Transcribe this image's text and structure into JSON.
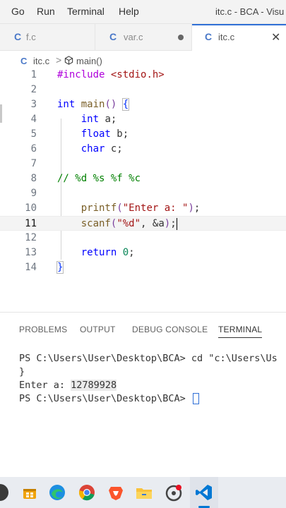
{
  "menubar": {
    "items": [
      "Go",
      "Run",
      "Terminal",
      "Help"
    ],
    "window_title": "itc.c - BCA - Visu"
  },
  "tabs": [
    {
      "icon": "C",
      "label": "f.c"
    },
    {
      "icon": "C",
      "label": "var.c",
      "modified": true
    },
    {
      "icon": "C",
      "label": "itc.c",
      "active": true,
      "close": "✕"
    }
  ],
  "breadcrumb": {
    "file_icon": "C",
    "file": "itc.c",
    "separator": ">",
    "symbol": "main()"
  },
  "code_lines": [
    {
      "n": "1",
      "text": "#include <stdio.h>"
    },
    {
      "n": "2",
      "text": ""
    },
    {
      "n": "3",
      "text": "int main() {"
    },
    {
      "n": "4",
      "text": "    int a;"
    },
    {
      "n": "5",
      "text": "    float b;"
    },
    {
      "n": "6",
      "text": "    char c;"
    },
    {
      "n": "7",
      "text": ""
    },
    {
      "n": "8",
      "text": "// %d %s %f %c"
    },
    {
      "n": "9",
      "text": ""
    },
    {
      "n": "10",
      "text": "    printf(\"Enter a: \");"
    },
    {
      "n": "11",
      "text": "    scanf(\"%d\", &a);"
    },
    {
      "n": "12",
      "text": ""
    },
    {
      "n": "13",
      "text": "    return 0;"
    },
    {
      "n": "14",
      "text": "}"
    }
  ],
  "panel": {
    "tabs": [
      "PROBLEMS",
      "OUTPUT",
      "DEBUG CONSOLE",
      "TERMINAL"
    ],
    "active_tab": "TERMINAL",
    "terminal": {
      "line1": "PS C:\\Users\\User\\Desktop\\BCA> cd \"c:\\Users\\Us",
      "line2": "}",
      "line3_prompt": "Enter a: ",
      "line3_input": "12789928",
      "line4": "PS C:\\Users\\User\\Desktop\\BCA> "
    }
  },
  "taskbar": {
    "icons": [
      "start-icon",
      "task-view-icon",
      "edge-icon",
      "chrome-icon",
      "brave-icon",
      "file-explorer-icon",
      "media-icon",
      "vscode-icon"
    ]
  }
}
